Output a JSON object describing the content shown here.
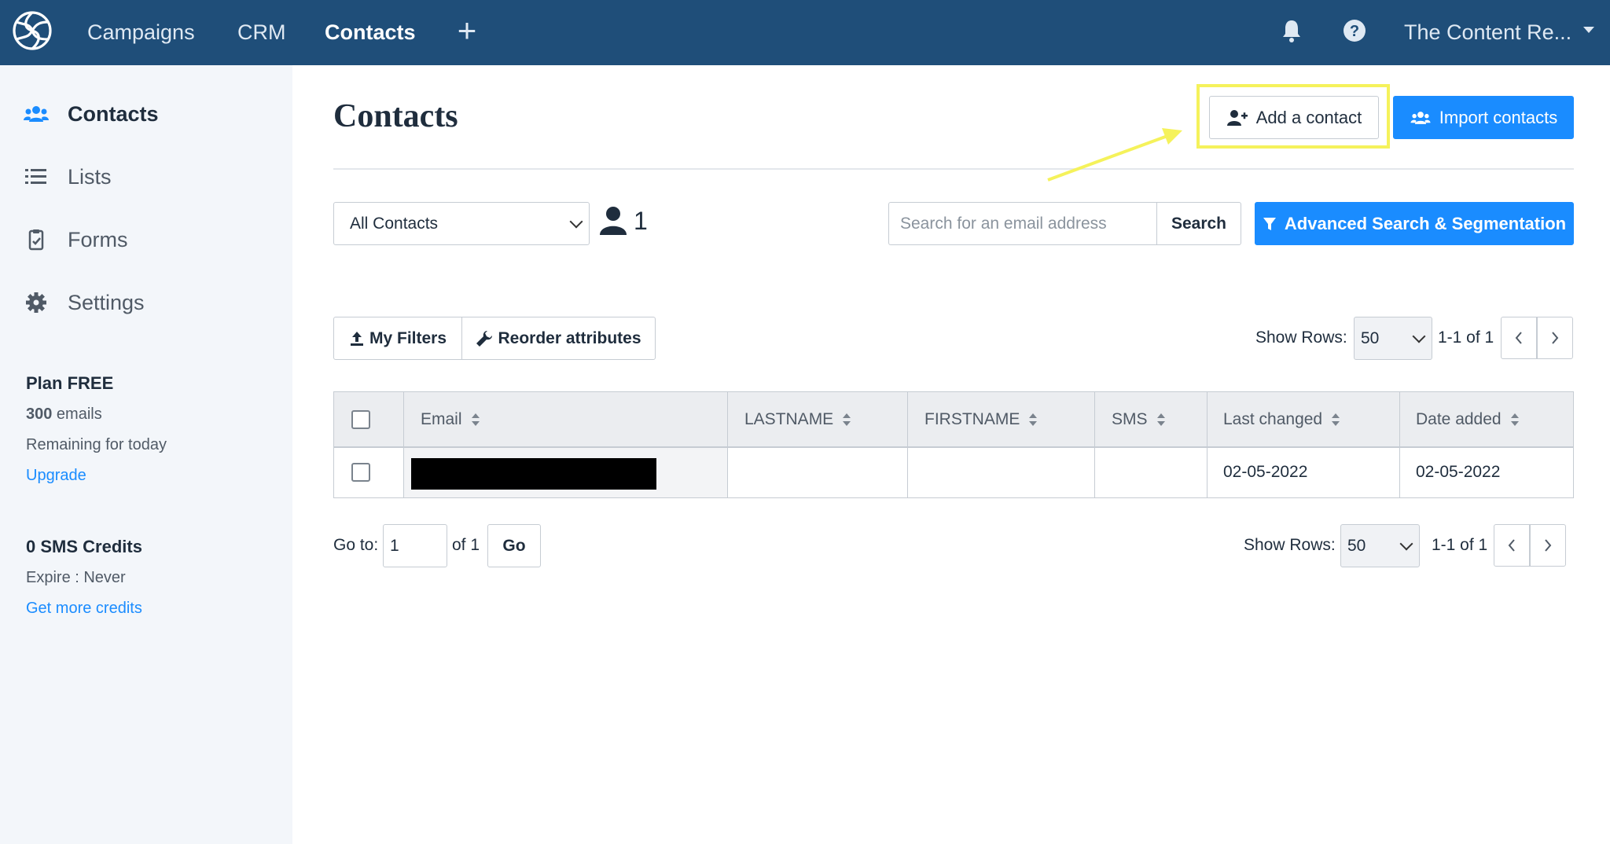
{
  "topbar": {
    "logo_icon": "sendinblue-logo-icon",
    "nav": [
      {
        "label": "Campaigns"
      },
      {
        "label": "CRM"
      },
      {
        "label": "Contacts",
        "active": true
      }
    ],
    "add_icon": "plus-icon",
    "notification_icon": "bell-icon",
    "help_icon": "help-icon",
    "account_label": "The Content Re...",
    "bar_color": "#1f4e79"
  },
  "sidebar": {
    "items": [
      {
        "label": "Contacts",
        "icon": "users-icon",
        "active": true
      },
      {
        "label": "Lists",
        "icon": "list-icon"
      },
      {
        "label": "Forms",
        "icon": "clipboard-icon"
      },
      {
        "label": "Settings",
        "icon": "gear-icon"
      }
    ],
    "plan_title": "Plan FREE",
    "plan_emails_count": "300",
    "plan_emails_suffix": " emails",
    "plan_remaining": "Remaining for today",
    "upgrade_link": "Upgrade",
    "sms_title": "0 SMS Credits",
    "sms_expire": "Expire : Never",
    "sms_link": "Get more credits"
  },
  "main": {
    "title": "Contacts",
    "add_contact_label": "Add a contact",
    "import_contacts_label": "Import contacts",
    "list_select_value": "All Contacts",
    "contact_count": "1",
    "search_placeholder": "Search for an email address",
    "search_label": "Search",
    "advanced_search_label": "Advanced Search & Segmentation",
    "my_filters_label": "My Filters",
    "reorder_label": "Reorder attributes",
    "show_rows_label": "Show Rows:",
    "rows_value": "50",
    "range_label": "1-1 of 1",
    "goto_label": "Go to:",
    "goto_value": "1",
    "of_label": "of 1",
    "go_label": "Go",
    "accent_color": "#1a8cff",
    "highlight_color": "#f5f25b"
  },
  "table": {
    "headers": [
      "Email",
      "LASTNAME",
      "FIRSTNAME",
      "SMS",
      "Last changed",
      "Date added"
    ],
    "rows": [
      {
        "email": "",
        "lastname": "",
        "firstname": "",
        "sms": "",
        "last_changed": "02-05-2022",
        "date_added": "02-05-2022"
      }
    ]
  }
}
